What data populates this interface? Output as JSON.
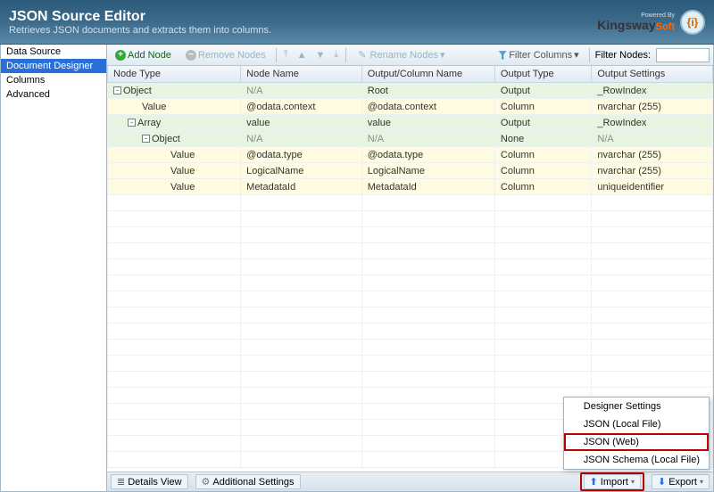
{
  "header": {
    "title": "JSON Source Editor",
    "subtitle": "Retrieves JSON documents and extracts them into columns.",
    "powered_by": "Powered By",
    "brand_a": "Kingsway",
    "brand_b": "Soft",
    "badge": "{i}"
  },
  "sidebar": {
    "items": [
      "Data Source",
      "Document Designer",
      "Columns",
      "Advanced"
    ],
    "selected_index": 1
  },
  "toolbar": {
    "add_node": "Add Node",
    "remove_nodes": "Remove Nodes",
    "rename_nodes": "Rename Nodes",
    "filter_columns": "Filter Columns",
    "filter_nodes": "Filter Nodes:",
    "filter_value": ""
  },
  "columns": [
    "Node Type",
    "Node Name",
    "Output/Column Name",
    "Output Type",
    "Output Settings"
  ],
  "rows": [
    {
      "cls": "green",
      "indent": 0,
      "toggle": "-",
      "type": "Object",
      "name": "N/A",
      "na_name": true,
      "out": "Root",
      "otype": "Output",
      "oset": "_RowIndex"
    },
    {
      "cls": "yellow",
      "indent": 1,
      "toggle": "",
      "type": "Value",
      "name": "@odata.context",
      "out": "@odata.context",
      "otype": "Column",
      "oset": "nvarchar (255)"
    },
    {
      "cls": "green",
      "indent": 1,
      "toggle": "-",
      "type": "Array",
      "name": "value",
      "out": "value",
      "otype": "Output",
      "oset": "_RowIndex"
    },
    {
      "cls": "green",
      "indent": 2,
      "toggle": "-",
      "type": "Object",
      "name": "N/A",
      "na_name": true,
      "out": "N/A",
      "na_out": true,
      "otype": "None",
      "oset": "N/A",
      "na_oset": true
    },
    {
      "cls": "yellow",
      "indent": 3,
      "toggle": "",
      "type": "Value",
      "name": "@odata.type",
      "out": "@odata.type",
      "otype": "Column",
      "oset": "nvarchar (255)"
    },
    {
      "cls": "yellow",
      "indent": 3,
      "toggle": "",
      "type": "Value",
      "name": "LogicalName",
      "out": "LogicalName",
      "otype": "Column",
      "oset": "nvarchar (255)"
    },
    {
      "cls": "yellow",
      "indent": 3,
      "toggle": "",
      "type": "Value",
      "name": "MetadataId",
      "out": "MetadataId",
      "otype": "Column",
      "oset": "uniqueidentifier"
    }
  ],
  "empty_rows": 17,
  "footer": {
    "details_view": "Details View",
    "additional_settings": "Additional Settings",
    "import": "Import",
    "export": "Export"
  },
  "popup": {
    "items": [
      "Designer Settings",
      "JSON (Local File)",
      "JSON (Web)",
      "JSON Schema (Local File)"
    ],
    "highlight_index": 2
  }
}
